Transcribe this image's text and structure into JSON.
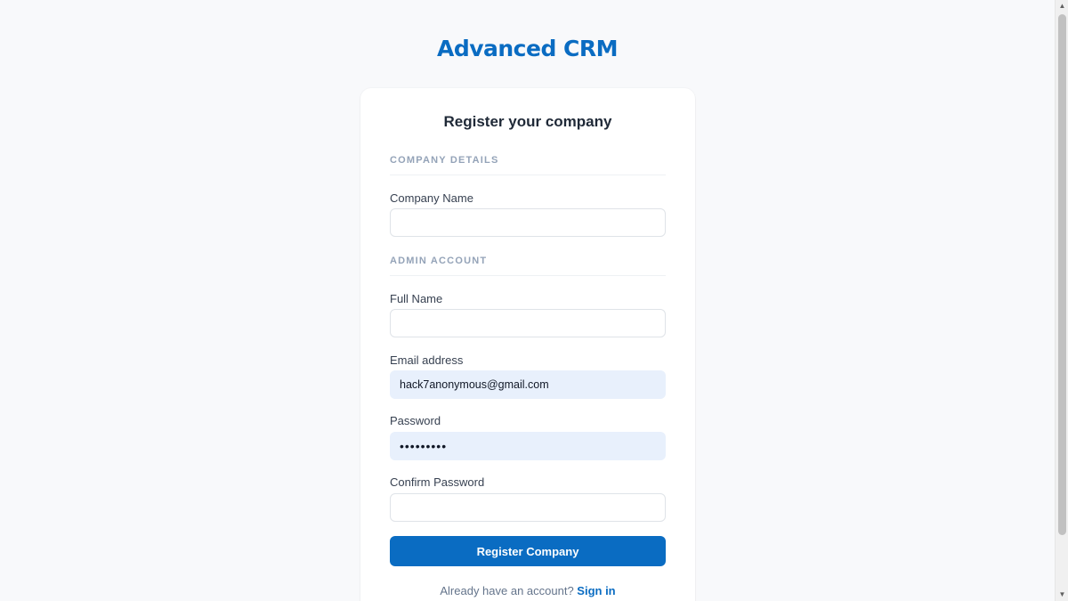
{
  "brand": "Advanced CRM",
  "card": {
    "title": "Register your company",
    "sections": {
      "company": "COMPANY DETAILS",
      "admin": "ADMIN ACCOUNT"
    },
    "fields": {
      "company_name": {
        "label": "Company Name",
        "value": ""
      },
      "full_name": {
        "label": "Full Name",
        "value": ""
      },
      "email": {
        "label": "Email address",
        "value": "hack7anonymous@gmail.com"
      },
      "password": {
        "label": "Password",
        "value": "•••••••••"
      },
      "confirm_password": {
        "label": "Confirm Password",
        "value": ""
      }
    },
    "submit_label": "Register Company",
    "footer": {
      "prompt": "Already have an account?",
      "link": "Sign in"
    }
  },
  "colors": {
    "accent": "#0a6cc2",
    "autofill": "#e8f0fc",
    "background": "#f8f9fb"
  },
  "icons": {
    "scroll_up": "scroll-up-arrow",
    "scroll_down": "scroll-down-arrow"
  }
}
